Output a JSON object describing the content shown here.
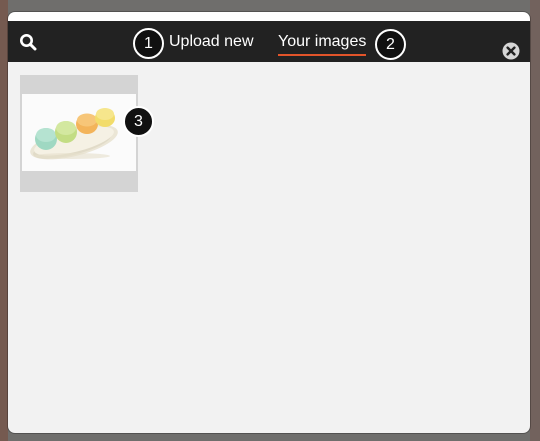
{
  "header": {
    "tabs": [
      {
        "label": "Upload new",
        "active": false
      },
      {
        "label": "Your images",
        "active": true
      }
    ],
    "active_tab_underline_color": "#e2542a",
    "background_color": "#222222"
  },
  "icons": {
    "search": "search-icon",
    "close": "close-icon"
  },
  "callouts": [
    "1",
    "2",
    "3"
  ],
  "gallery": {
    "images": [
      {
        "subject": "pastel macarons on an oval plate"
      }
    ]
  }
}
